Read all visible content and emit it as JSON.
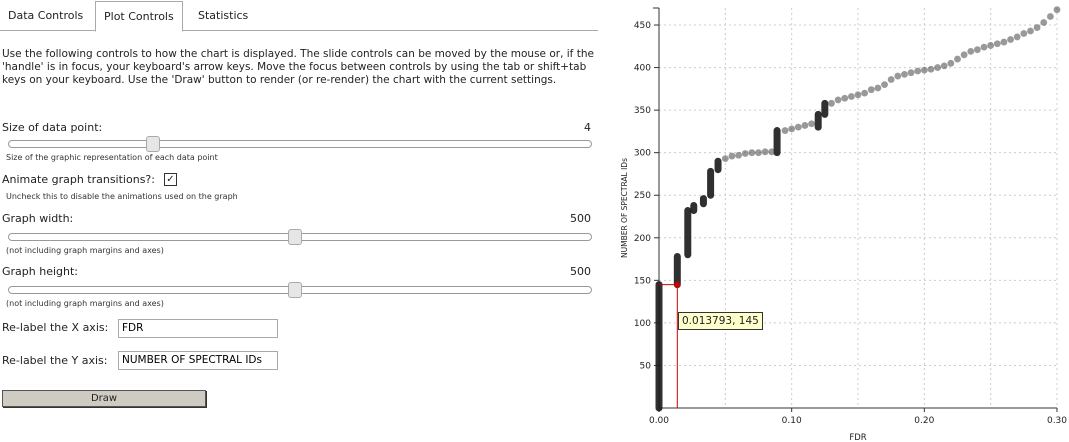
{
  "tabs": [
    "Data Controls",
    "Plot Controls",
    "Statistics"
  ],
  "intro": "Use the following controls to how the chart is displayed. The slide controls can be moved by the mouse or, if the 'handle' is in focus, your keyboard's arrow keys. Move the focus between controls by using the tab or shift+tab keys on your keyboard. Use the 'Draw' button to render (or re-render) the chart with the current settings.",
  "point_size": {
    "label": "Size of data point:",
    "value": "4",
    "help": "Size of the graphic representation of each data point",
    "level": 0.25
  },
  "animate": {
    "label": "Animate graph transitions?:",
    "checked": "✓",
    "help": "Uncheck this to disable the animations used on the graph"
  },
  "graph_width": {
    "label": "Graph width:",
    "value": "500",
    "help": "(not including graph margins and axes)",
    "level": 0.5
  },
  "graph_height": {
    "label": "Graph height:",
    "value": "500",
    "help": "(not including graph margins and axes)",
    "level": 0.5
  },
  "x_axis": {
    "label": "Re-label the X axis:",
    "value": "FDR"
  },
  "y_axis": {
    "label": "Re-label the Y axis:",
    "value": "NUMBER OF SPECTRAL IDs"
  },
  "draw_label": "Draw",
  "tooltip": "0.013793, 145",
  "colors": {
    "points": "#222222",
    "highlight": "#cc0000",
    "tooltip_bg": "#ffffcc"
  },
  "chart_data": {
    "type": "scatter",
    "xlabel": "FDR",
    "ylabel": "NUMBER OF SPECTRAL IDs",
    "xlim": [
      0,
      0.3
    ],
    "ylim": [
      0,
      470
    ],
    "xticks": [
      "0.00",
      "0.10",
      "0.20",
      "0.30"
    ],
    "yticks": [
      50,
      100,
      150,
      200,
      250,
      300,
      350,
      400,
      450
    ],
    "grid": true,
    "highlight": {
      "x": 0.013793,
      "y": 145
    },
    "segments": [
      {
        "x": 0.0,
        "y0": 0,
        "y1": 145
      },
      {
        "x": 0.0138,
        "y0": 145,
        "y1": 178
      },
      {
        "x": 0.0217,
        "y0": 180,
        "y1": 232
      },
      {
        "x": 0.0262,
        "y0": 232,
        "y1": 238
      },
      {
        "x": 0.0335,
        "y0": 240,
        "y1": 246
      },
      {
        "x": 0.0389,
        "y0": 250,
        "y1": 278
      },
      {
        "x": 0.0445,
        "y0": 280,
        "y1": 290
      },
      {
        "x": 0.089,
        "y0": 300,
        "y1": 326
      },
      {
        "x": 0.12,
        "y0": 330,
        "y1": 345
      },
      {
        "x": 0.125,
        "y0": 345,
        "y1": 358
      }
    ],
    "points": [
      [
        0.05,
        293
      ],
      [
        0.055,
        296
      ],
      [
        0.06,
        297
      ],
      [
        0.065,
        299
      ],
      [
        0.07,
        300
      ],
      [
        0.075,
        300
      ],
      [
        0.08,
        301
      ],
      [
        0.085,
        301
      ],
      [
        0.095,
        326
      ],
      [
        0.1,
        328
      ],
      [
        0.105,
        330
      ],
      [
        0.11,
        332
      ],
      [
        0.115,
        334
      ],
      [
        0.13,
        358
      ],
      [
        0.135,
        362
      ],
      [
        0.14,
        364
      ],
      [
        0.145,
        366
      ],
      [
        0.15,
        368
      ],
      [
        0.155,
        370
      ],
      [
        0.16,
        374
      ],
      [
        0.165,
        376
      ],
      [
        0.17,
        380
      ],
      [
        0.175,
        386
      ],
      [
        0.18,
        390
      ],
      [
        0.185,
        392
      ],
      [
        0.19,
        394
      ],
      [
        0.195,
        396
      ],
      [
        0.2,
        397
      ],
      [
        0.205,
        398
      ],
      [
        0.21,
        400
      ],
      [
        0.215,
        402
      ],
      [
        0.22,
        405
      ],
      [
        0.225,
        410
      ],
      [
        0.23,
        415
      ],
      [
        0.235,
        419
      ],
      [
        0.24,
        421
      ],
      [
        0.245,
        424
      ],
      [
        0.25,
        426
      ],
      [
        0.255,
        428
      ],
      [
        0.26,
        430
      ],
      [
        0.265,
        433
      ],
      [
        0.27,
        436
      ],
      [
        0.275,
        440
      ],
      [
        0.28,
        443
      ],
      [
        0.285,
        447
      ],
      [
        0.29,
        453
      ],
      [
        0.295,
        460
      ],
      [
        0.3,
        468
      ]
    ]
  }
}
